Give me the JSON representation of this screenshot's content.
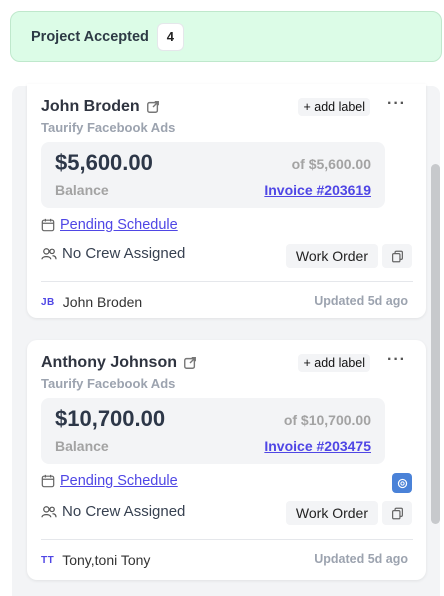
{
  "column": {
    "title": "Project Accepted",
    "count": "4"
  },
  "cards": [
    {
      "client": "John Broden",
      "source": "Taurify Facebook Ads",
      "add_label": "+ add label",
      "more": "···",
      "amount": "$5,600.00",
      "balance_label": "Balance",
      "of_total": "of $5,600.00",
      "invoice": "Invoice #203619",
      "schedule": "Pending Schedule",
      "crew": "No Crew Assigned",
      "work_order": "Work Order",
      "assignee_initials": "JB",
      "assignee": "John Broden",
      "updated": "Updated 5d ago"
    },
    {
      "client": "Anthony Johnson",
      "source": "Taurify Facebook Ads",
      "add_label": "+ add label",
      "more": "···",
      "amount": "$10,700.00",
      "balance_label": "Balance",
      "of_total": "of $10,700.00",
      "invoice": "Invoice #203475",
      "schedule": "Pending Schedule",
      "crew": "No Crew Assigned",
      "work_order": "Work Order",
      "assignee_initials": "TT",
      "assignee": "Tony,toni Tony",
      "updated": "Updated 5d ago"
    }
  ],
  "colors": {
    "header_bg": "#dcfce7",
    "accent": "#4f46e5",
    "lane_bg": "#f3f4f6"
  }
}
